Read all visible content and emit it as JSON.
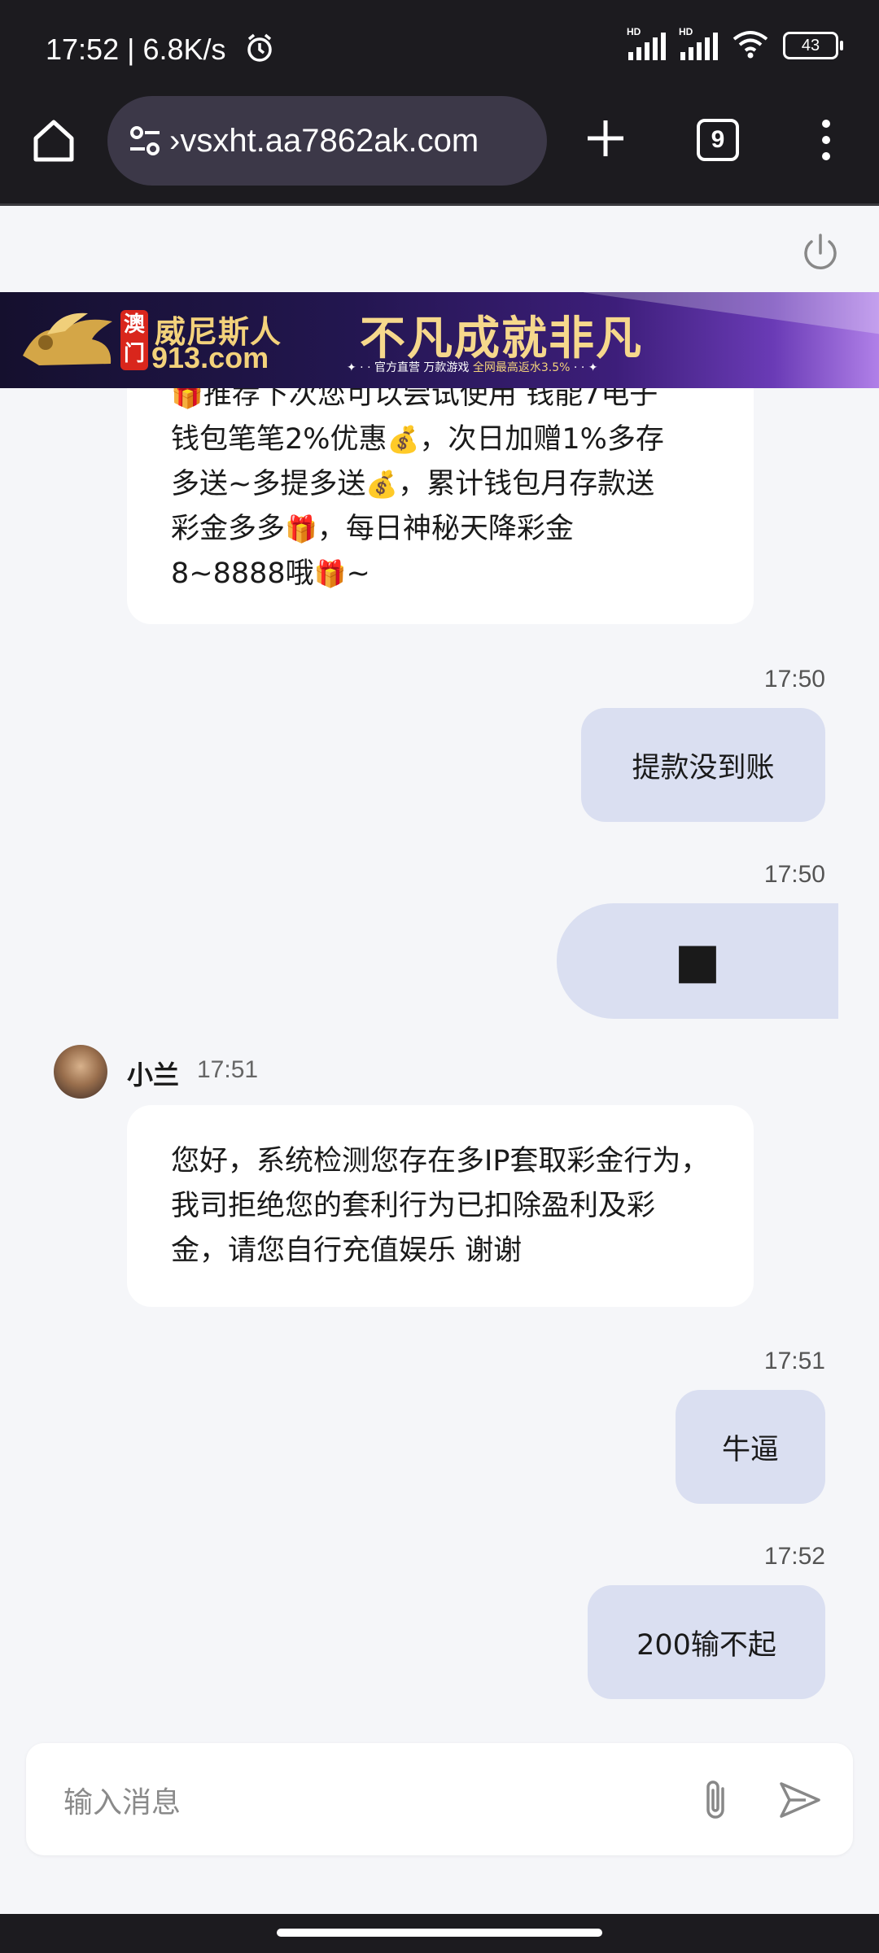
{
  "status_bar": {
    "time": "17:52 | 6.8K/s",
    "battery": "43",
    "hd1": "HD",
    "hd2": "HD"
  },
  "browser": {
    "url": "›vsxht.aa7862ak.com",
    "tab_count": "9"
  },
  "banner": {
    "badge_top": "澳",
    "badge_bottom": "门",
    "brand_name": "威尼斯人",
    "brand_domain": "913.com",
    "slogan": "不凡成就非凡",
    "sub_prefix": "✦ · · 官方直营  万款游戏 ",
    "sub_highlight": "全网最高返水3.5%",
    "sub_suffix": " · · ✦"
  },
  "messages": {
    "m1_line1": "推荐下次您可以尝试使用 钱能7电子",
    "m1_line2a": "钱包笔笔2%优惠",
    "m1_line2b": "，次日加赠1%多存",
    "m1_line3a": "多送~多提多送",
    "m1_line3b": "，累计钱包月存款送",
    "m1_line4a": "彩金多多",
    "m1_line4b": "，每日神秘天降彩金",
    "m1_line5a": "8~8888哦",
    "m1_line5b": "~",
    "t1": "17:50",
    "m2": "提款没到账",
    "t2": "17:50",
    "m3": "■",
    "agent_name": "小兰",
    "agent_time": "17:51",
    "m4": "您好，系统检测您存在多IP套取彩金行为，我司拒绝您的套利行为已扣除盈利及彩金，请您自行充值娱乐 谢谢",
    "t3": "17:51",
    "m5": "牛逼",
    "t4": "17:52",
    "m6": "200输不起"
  },
  "input": {
    "placeholder": "输入消息"
  },
  "icons": {
    "money": "💰",
    "gift": "🎁"
  }
}
